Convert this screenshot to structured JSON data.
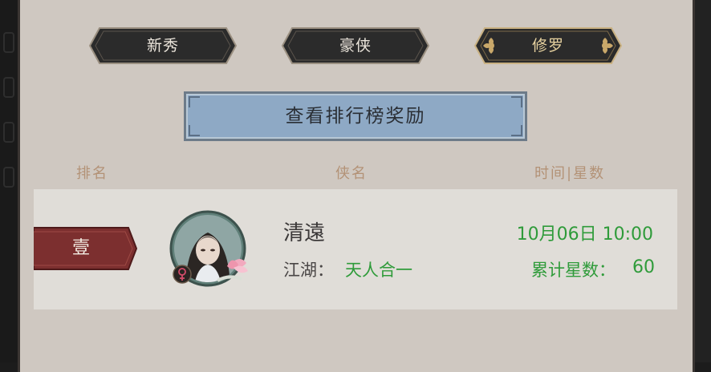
{
  "tabs": [
    {
      "label": "新秀",
      "active": false
    },
    {
      "label": "豪侠",
      "active": false
    },
    {
      "label": "修罗",
      "active": true
    }
  ],
  "reward_button": {
    "label": "查看排行榜奖励"
  },
  "headers": {
    "rank": "排名",
    "name": "侠名",
    "time_stars": "时间|星数"
  },
  "entry": {
    "rank": "壹",
    "name": "清遠",
    "jianghu_label": "江湖：",
    "jianghu_value": "天人合一",
    "time": "10月06日 10:00",
    "stars_label": "累计星数：",
    "stars_value": "60",
    "gender_icon": "female-icon"
  },
  "colors": {
    "accent_green": "#2f9b3a",
    "rank_ribbon": "#7c2f2f",
    "button_blue": "#8ea9c5"
  }
}
